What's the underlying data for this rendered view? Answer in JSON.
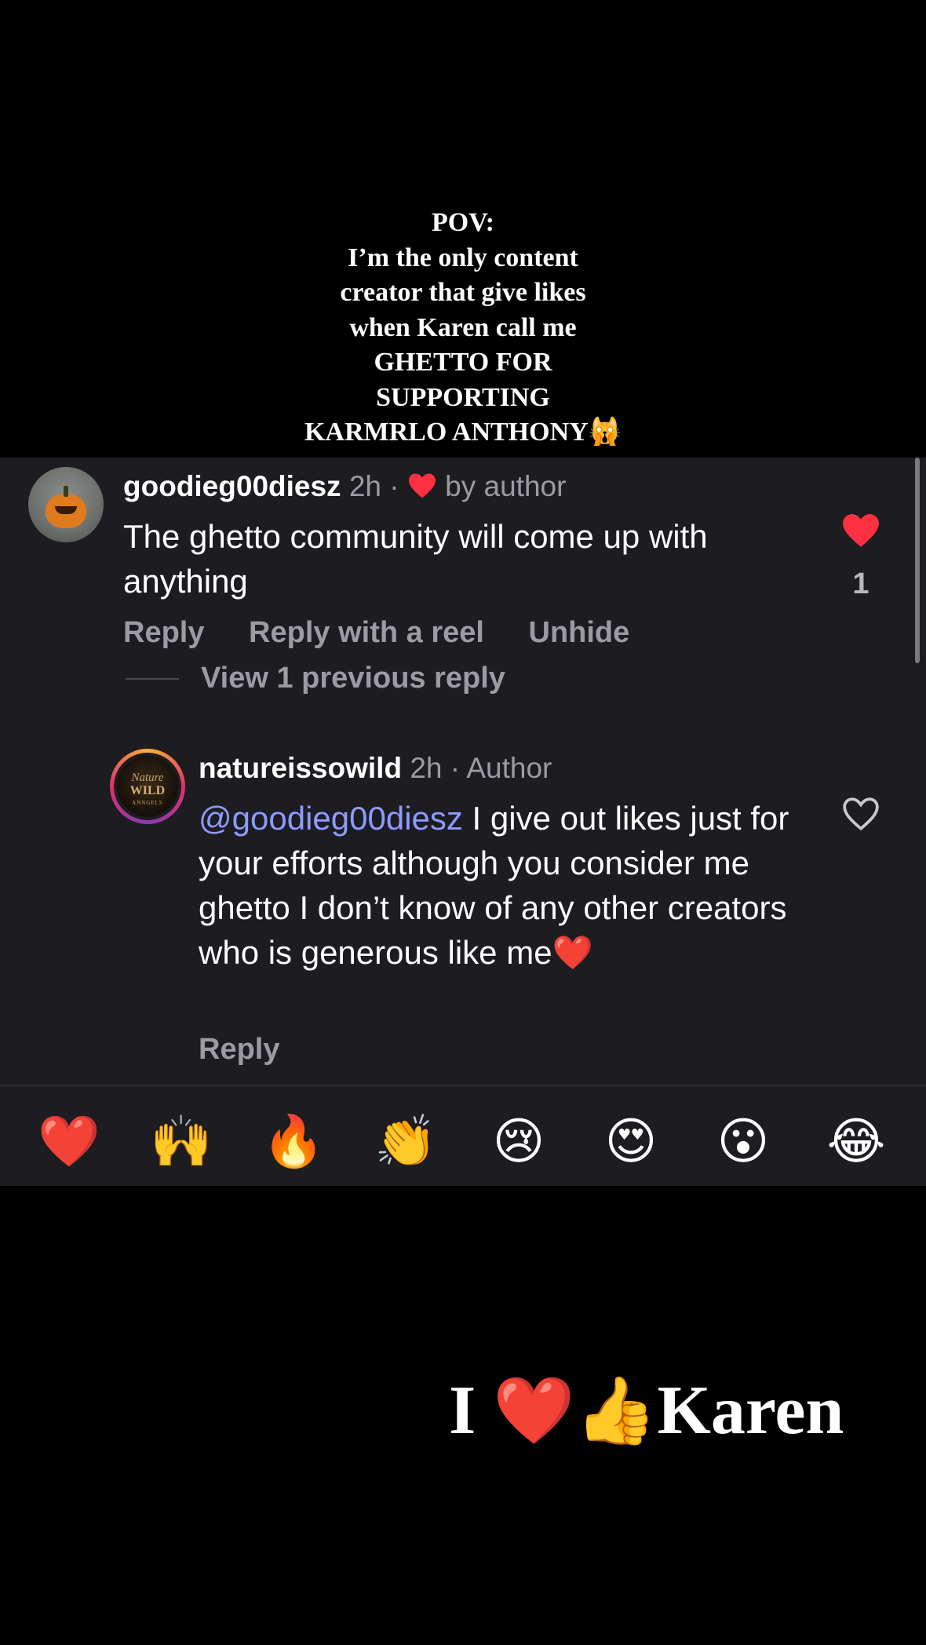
{
  "overlay": {
    "pov_lines": [
      "POV:",
      "I’m the only content",
      "creator that give likes",
      "when Karen call me",
      "GHETTO FOR",
      "SUPPORTING",
      "KARMRLO ANTHONY🙀"
    ],
    "bottom_caption": {
      "prefix": "I ",
      "emojis": "❤️👍",
      "suffix": "Karen"
    }
  },
  "comments": [
    {
      "username": "goodieg00diesz",
      "time": "2h",
      "separator": "·",
      "badge": "by author",
      "text": "The ghetto community will come up with anything",
      "like_count": "1",
      "liked": true,
      "actions": [
        "Reply",
        "Reply with a reel",
        "Unhide"
      ],
      "view_replies": "View 1 previous reply"
    },
    {
      "username": "natureissowild",
      "time": "2h",
      "separator": "·",
      "badge": "Author",
      "mention": "@goodieg00diesz",
      "text": " I give out likes just for your efforts although you consider me ghetto I don’t know of any other creators who is generous like me❤️",
      "liked": false,
      "actions": [
        "Reply"
      ],
      "avatar_text": [
        "Nature",
        "WILD",
        "ANNGELS"
      ]
    }
  ],
  "emoji_reactions": [
    "❤️",
    "🙌",
    "🔥",
    "👏",
    "😢",
    "😍",
    "😮",
    "😂"
  ],
  "colors": {
    "panel_bg": "#1c1c21",
    "muted_text": "#9b9ca3",
    "mention": "#8c9bff",
    "like_red": "#ff3040"
  },
  "icons": {
    "like_filled": "heart-filled-icon",
    "like_outline": "heart-outline-icon",
    "author_heart": "small-heart-icon"
  }
}
